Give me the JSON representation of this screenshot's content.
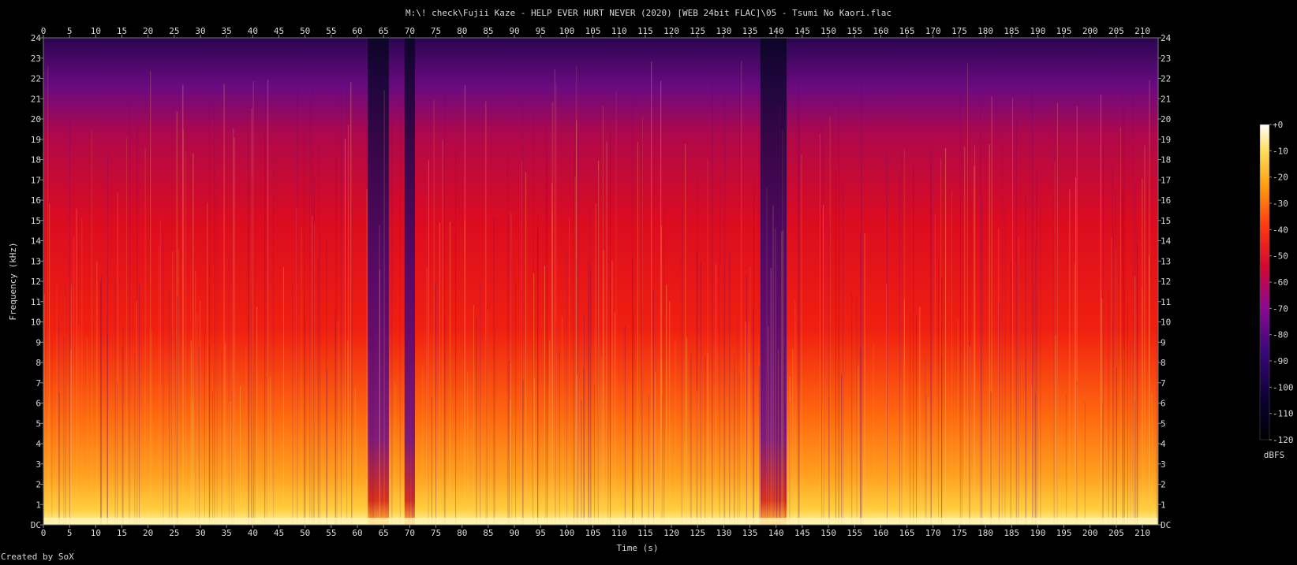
{
  "title": "M:\\! check\\Fujii Kaze - HELP EVER HURT NEVER (2020) [WEB 24bit FLAC]\\05 - Tsumi No Kaori.flac",
  "footer": "Created by SoX",
  "chart_data": {
    "type": "heatmap",
    "title": "M:\\! check\\Fujii Kaze - HELP EVER HURT NEVER (2020) [WEB 24bit FLAC]\\05 - Tsumi No Kaori.flac",
    "xlabel": "Time (s)",
    "ylabel": "Frequency (kHz)",
    "xlim": [
      0,
      213
    ],
    "ylim": [
      0,
      24
    ],
    "x_ticks": [
      "0",
      "5",
      "10",
      "15",
      "20",
      "25",
      "30",
      "35",
      "40",
      "45",
      "50",
      "55",
      "60",
      "65",
      "70",
      "75",
      "80",
      "85",
      "90",
      "95",
      "100",
      "105",
      "110",
      "115",
      "120",
      "125",
      "130",
      "135",
      "140",
      "145",
      "150",
      "155",
      "160",
      "165",
      "170",
      "175",
      "180",
      "185",
      "190",
      "195",
      "200",
      "205",
      "210"
    ],
    "y_ticks": [
      "DC",
      "1",
      "2",
      "3",
      "4",
      "5",
      "6",
      "7",
      "8",
      "9",
      "10",
      "11",
      "12",
      "13",
      "14",
      "15",
      "16",
      "17",
      "18",
      "19",
      "20",
      "21",
      "22",
      "23",
      "24"
    ],
    "colorbar": {
      "label": "dBFS",
      "ticks": [
        "+0",
        "-10",
        "-20",
        "-30",
        "-40",
        "-50",
        "-60",
        "-70",
        "-80",
        "-90",
        "-100",
        "-110",
        "-120"
      ],
      "range": [
        -120,
        0
      ]
    },
    "quiet_regions_s": [
      [
        62,
        66
      ],
      [
        69,
        71
      ],
      [
        137,
        142
      ]
    ],
    "track_end_s": 213,
    "colors": {
      "background": "#000000",
      "low": "#10004a",
      "mid": "#a0007a",
      "high": "#ff2a10",
      "peak": "#ffff90",
      "text": "#d8d8d8"
    }
  }
}
